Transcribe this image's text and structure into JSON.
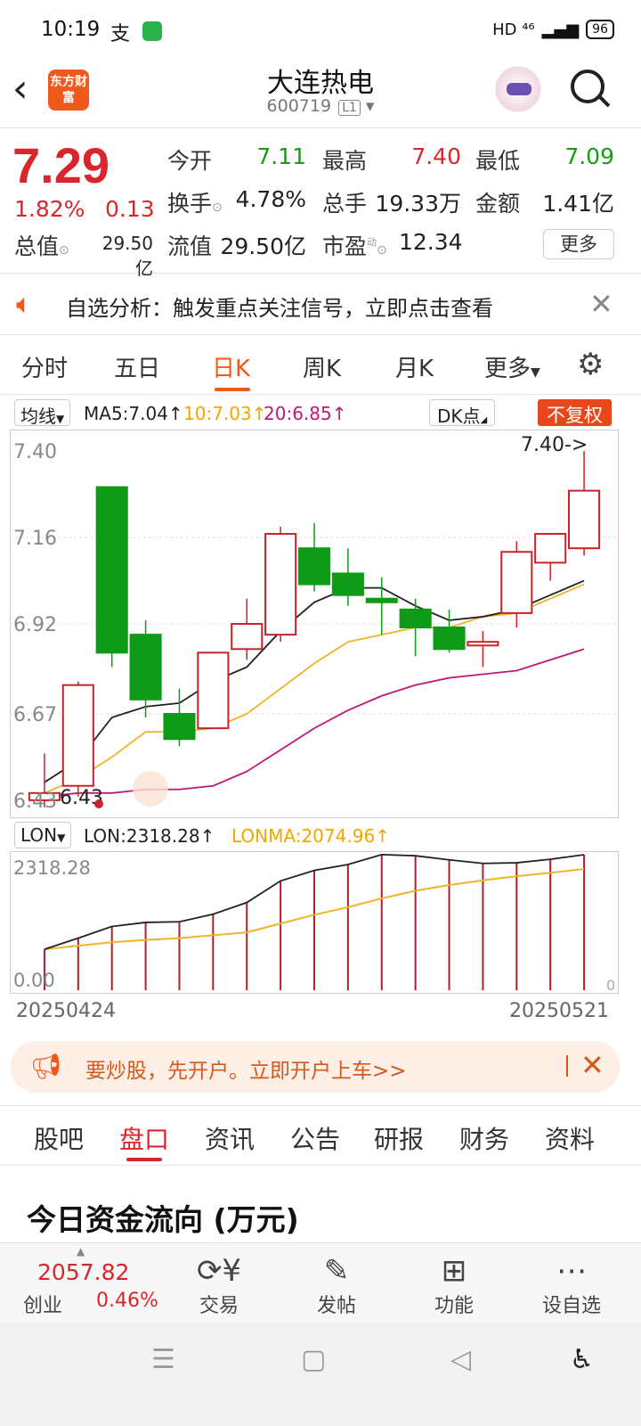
{
  "status_bar": {
    "time": "10:19",
    "network": "HD ⁴⁶",
    "battery": "96"
  },
  "header": {
    "logo_text": "东方财富",
    "title": "大连热电",
    "code": "600719",
    "level": "L1"
  },
  "quote": {
    "price": "7.29",
    "pct": "1.82%",
    "chg": "0.13",
    "fields": [
      {
        "label": "今开",
        "value": "7.11",
        "color": "green"
      },
      {
        "label": "最高",
        "value": "7.40",
        "color": "red"
      },
      {
        "label": "最低",
        "value": "7.09",
        "color": "green"
      },
      {
        "label": "换手",
        "value": "4.78%",
        "color": "black"
      },
      {
        "label": "总手",
        "value": "19.33万",
        "color": "black"
      },
      {
        "label": "金额",
        "value": "1.41亿",
        "color": "black"
      },
      {
        "label": "总值",
        "value": "29.50亿",
        "color": "black"
      },
      {
        "label": "流值",
        "value": "29.50亿",
        "color": "black"
      },
      {
        "label": "市盈",
        "value": "12.34",
        "color": "black"
      }
    ],
    "pe_tag": "动",
    "more_label": "更多"
  },
  "notice": {
    "text": "自选分析：触发重点关注信号，立即点击查看"
  },
  "period_tabs": [
    "分时",
    "五日",
    "日K",
    "周K",
    "月K",
    "更多"
  ],
  "active_period": "日K",
  "ma_legend": {
    "selector": "均线",
    "ma5": "MA5:7.04↑",
    "ma10": "10:7.03↑",
    "ma20": "20:6.85↑",
    "dk": "DK点",
    "adjust": "不复权"
  },
  "chart_data": [
    {
      "type": "candlestick",
      "y_ticks": [
        "7.40",
        "7.16",
        "6.92",
        "6.67",
        "6.43"
      ],
      "ylim": [
        6.4,
        7.44
      ],
      "high_marker": "7.40->",
      "low_marker": "6.43",
      "candles": [
        {
          "o": 6.43,
          "c": 6.45,
          "h": 6.56,
          "l": 6.41
        },
        {
          "o": 6.47,
          "c": 6.75,
          "h": 6.76,
          "l": 6.44
        },
        {
          "o": 7.3,
          "c": 6.84,
          "h": 7.3,
          "l": 6.8
        },
        {
          "o": 6.89,
          "c": 6.71,
          "h": 6.93,
          "l": 6.66
        },
        {
          "o": 6.67,
          "c": 6.6,
          "h": 6.74,
          "l": 6.58
        },
        {
          "o": 6.63,
          "c": 6.84,
          "h": 6.84,
          "l": 6.63
        },
        {
          "o": 6.85,
          "c": 6.92,
          "h": 6.99,
          "l": 6.82
        },
        {
          "o": 6.89,
          "c": 7.17,
          "h": 7.19,
          "l": 6.87
        },
        {
          "o": 7.13,
          "c": 7.03,
          "h": 7.2,
          "l": 7.01
        },
        {
          "o": 7.06,
          "c": 7.0,
          "h": 7.13,
          "l": 6.97
        },
        {
          "o": 6.99,
          "c": 6.98,
          "h": 7.05,
          "l": 6.89
        },
        {
          "o": 6.96,
          "c": 6.91,
          "h": 6.99,
          "l": 6.83
        },
        {
          "o": 6.91,
          "c": 6.85,
          "h": 6.96,
          "l": 6.84
        },
        {
          "o": 6.86,
          "c": 6.87,
          "h": 6.9,
          "l": 6.8
        },
        {
          "o": 6.95,
          "c": 7.12,
          "h": 7.15,
          "l": 6.91
        },
        {
          "o": 7.09,
          "c": 7.17,
          "h": 7.17,
          "l": 7.04
        },
        {
          "o": 7.13,
          "c": 7.29,
          "h": 7.4,
          "l": 7.11
        }
      ],
      "ma5": [
        6.48,
        6.54,
        6.66,
        6.69,
        6.7,
        6.76,
        6.8,
        6.9,
        6.98,
        7.02,
        7.02,
        6.97,
        6.93,
        6.94,
        6.96,
        7.0,
        7.04
      ],
      "ma10": [
        6.45,
        6.49,
        6.55,
        6.62,
        6.62,
        6.63,
        6.67,
        6.74,
        6.81,
        6.87,
        6.89,
        6.91,
        6.91,
        6.94,
        6.95,
        6.99,
        7.03
      ],
      "ma20": [
        6.44,
        6.45,
        6.45,
        6.46,
        6.46,
        6.47,
        6.51,
        6.57,
        6.63,
        6.68,
        6.72,
        6.75,
        6.77,
        6.78,
        6.79,
        6.82,
        6.85
      ]
    },
    {
      "type": "bar+line",
      "title": "LON",
      "selector": "LON",
      "lon_label": "LON:2318.28↑",
      "lonma_label": "LONMA:2074.96↑",
      "y_ticks": [
        "2318.28",
        "0.00"
      ],
      "right_tick": "0",
      "ylim": [
        0,
        2318.28
      ],
      "lon": [
        700,
        890,
        1090,
        1160,
        1170,
        1300,
        1500,
        1870,
        2050,
        2150,
        2320,
        2300,
        2230,
        2170,
        2180,
        2240,
        2318.28
      ],
      "lonma": [
        700,
        760,
        820,
        860,
        890,
        940,
        990,
        1140,
        1290,
        1420,
        1570,
        1700,
        1800,
        1880,
        1950,
        2010,
        2074.96
      ]
    }
  ],
  "dates": {
    "start": "20250424",
    "end": "20250521"
  },
  "ad": {
    "text": "要炒股，先开户。立即开户上车>>"
  },
  "section_tabs": [
    "股吧",
    "盘口",
    "资讯",
    "公告",
    "研报",
    "财务",
    "资料"
  ],
  "active_section": "盘口",
  "flow_title": "今日资金流向 (万元)",
  "toolbar": {
    "index_value": "2057.82",
    "index_name": "创业",
    "index_pct": "0.46%",
    "items": [
      {
        "label": "交易",
        "icon": "trade-icon"
      },
      {
        "label": "发帖",
        "icon": "post-icon"
      },
      {
        "label": "功能",
        "icon": "apps-icon"
      },
      {
        "label": "设自选",
        "icon": "favorite-icon"
      }
    ]
  }
}
